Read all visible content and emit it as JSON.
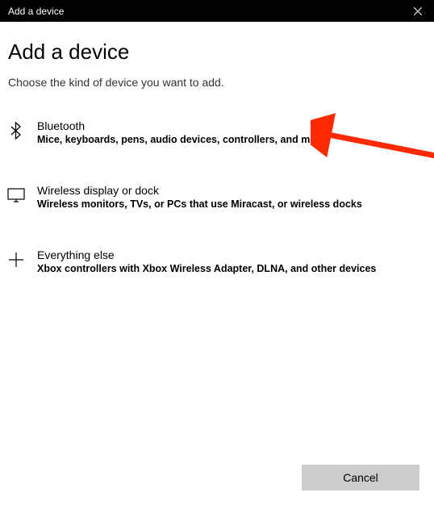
{
  "titlebar": {
    "title": "Add a device"
  },
  "header": {
    "heading": "Add a device",
    "subheading": "Choose the kind of device you want to add."
  },
  "options": [
    {
      "icon": "bluetooth-icon",
      "title": "Bluetooth",
      "desc": "Mice, keyboards, pens, audio devices, controllers, and more"
    },
    {
      "icon": "display-icon",
      "title": "Wireless display or dock",
      "desc": "Wireless monitors, TVs, or PCs that use Miracast, or wireless docks"
    },
    {
      "icon": "plus-icon",
      "title": "Everything else",
      "desc": "Xbox controllers with Xbox Wireless Adapter, DLNA, and other devices"
    }
  ],
  "footer": {
    "cancel_label": "Cancel"
  }
}
